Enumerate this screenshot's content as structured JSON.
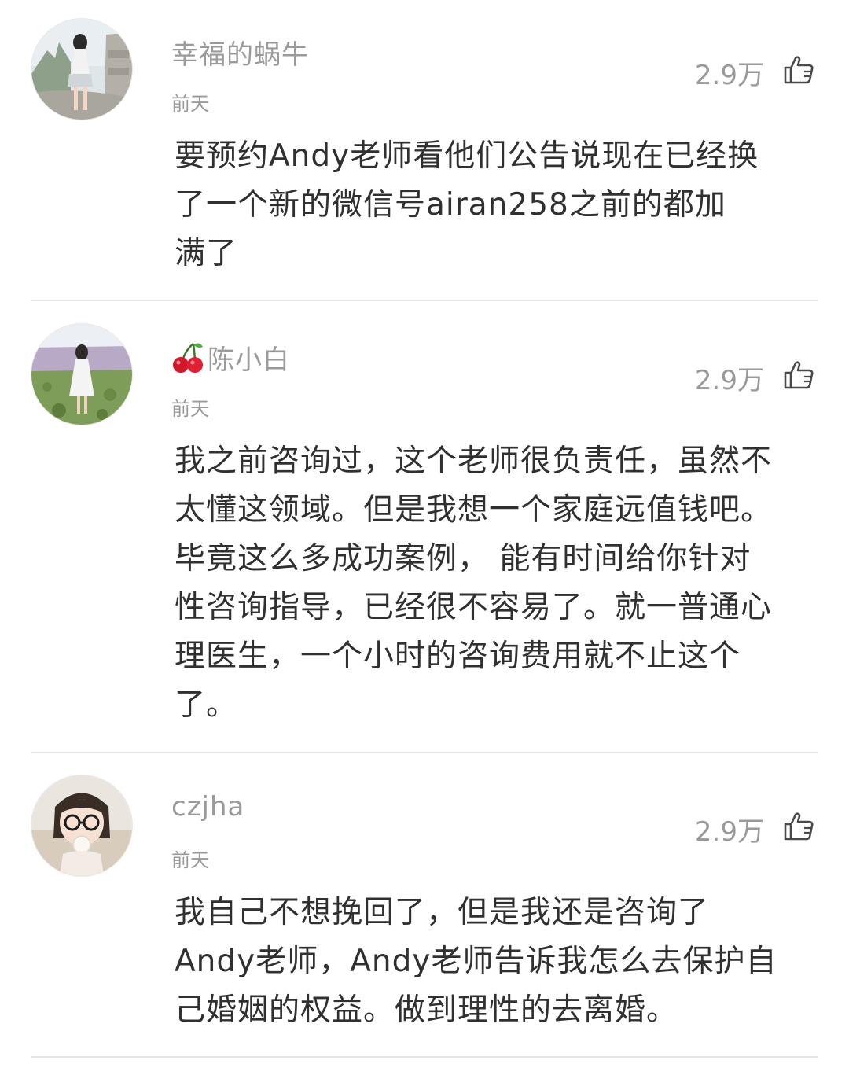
{
  "comments": [
    {
      "username": "幸福的蜗牛",
      "time": "前天",
      "likes": "2.9万",
      "avatar_icon": "avatar-girl-stone-gate",
      "content_lines": [
        "要预约Andy老师看他们公告说现在已经换",
        "了一个新的微信号airan258之前的都加",
        "满了"
      ]
    },
    {
      "username": "陈小白",
      "username_prefix_icon": "cherry-emoji",
      "time": "前天",
      "likes": "2.9万",
      "avatar_icon": "avatar-girl-flower-field",
      "content_lines": [
        "我之前咨询过，这个老师很负责任，虽然不",
        "太懂这领域。但是我想一个家庭远值钱吧。",
        "毕竟这么多成功案例，  能有时间给你针对",
        "性咨询指导，已经很不容易了。就一普通心",
        "理医生，一个小时的咨询费用就不止这个",
        "了。"
      ]
    },
    {
      "username": "czjha",
      "time": "前天",
      "likes": "2.9万",
      "avatar_icon": "avatar-girl-glasses",
      "content_lines": [
        "我自己不想挽回了，但是我还是咨询了",
        "Andy老师，Andy老师告诉我怎么去保护自",
        "己婚姻的权益。做到理性的去离婚。"
      ]
    }
  ],
  "icons": {
    "like": "thumbs-up-icon"
  },
  "colors": {
    "meta_text": "#9a9a9a",
    "body_text": "#303030",
    "divider": "#e6e6e6"
  }
}
